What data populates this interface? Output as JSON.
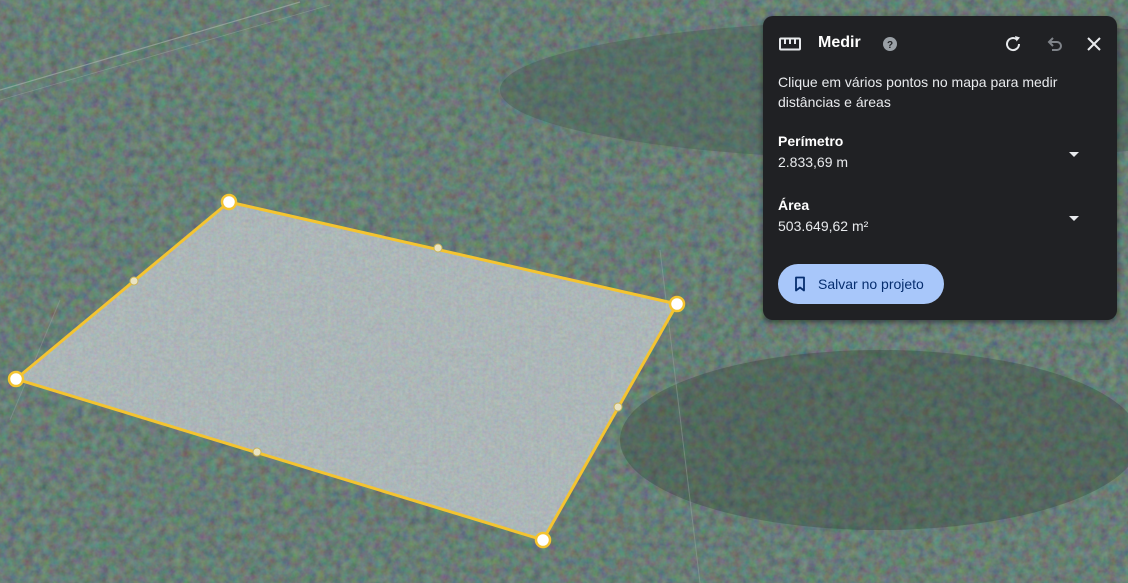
{
  "panel": {
    "title": "Medir",
    "instructions": "Clique em vários pontos no mapa para medir distâncias e áreas",
    "perimeter_label": "Perímetro",
    "perimeter_value": "2.833,69 m",
    "area_label": "Área",
    "area_value": "503.649,62 m²",
    "save_label": "Salvar no projeto",
    "icons": {
      "ruler": "ruler-icon",
      "help": "help-icon",
      "redo": "refresh-icon",
      "undo": "undo-icon",
      "close": "close-icon",
      "bookmark": "bookmark-icon",
      "dropdown": "chevron-down-icon"
    }
  },
  "colors": {
    "panel_bg": "#202124",
    "accent_button": "#a8c7fa",
    "polygon_stroke": "#f4c430",
    "polygon_fill": "#9aa3aa"
  }
}
